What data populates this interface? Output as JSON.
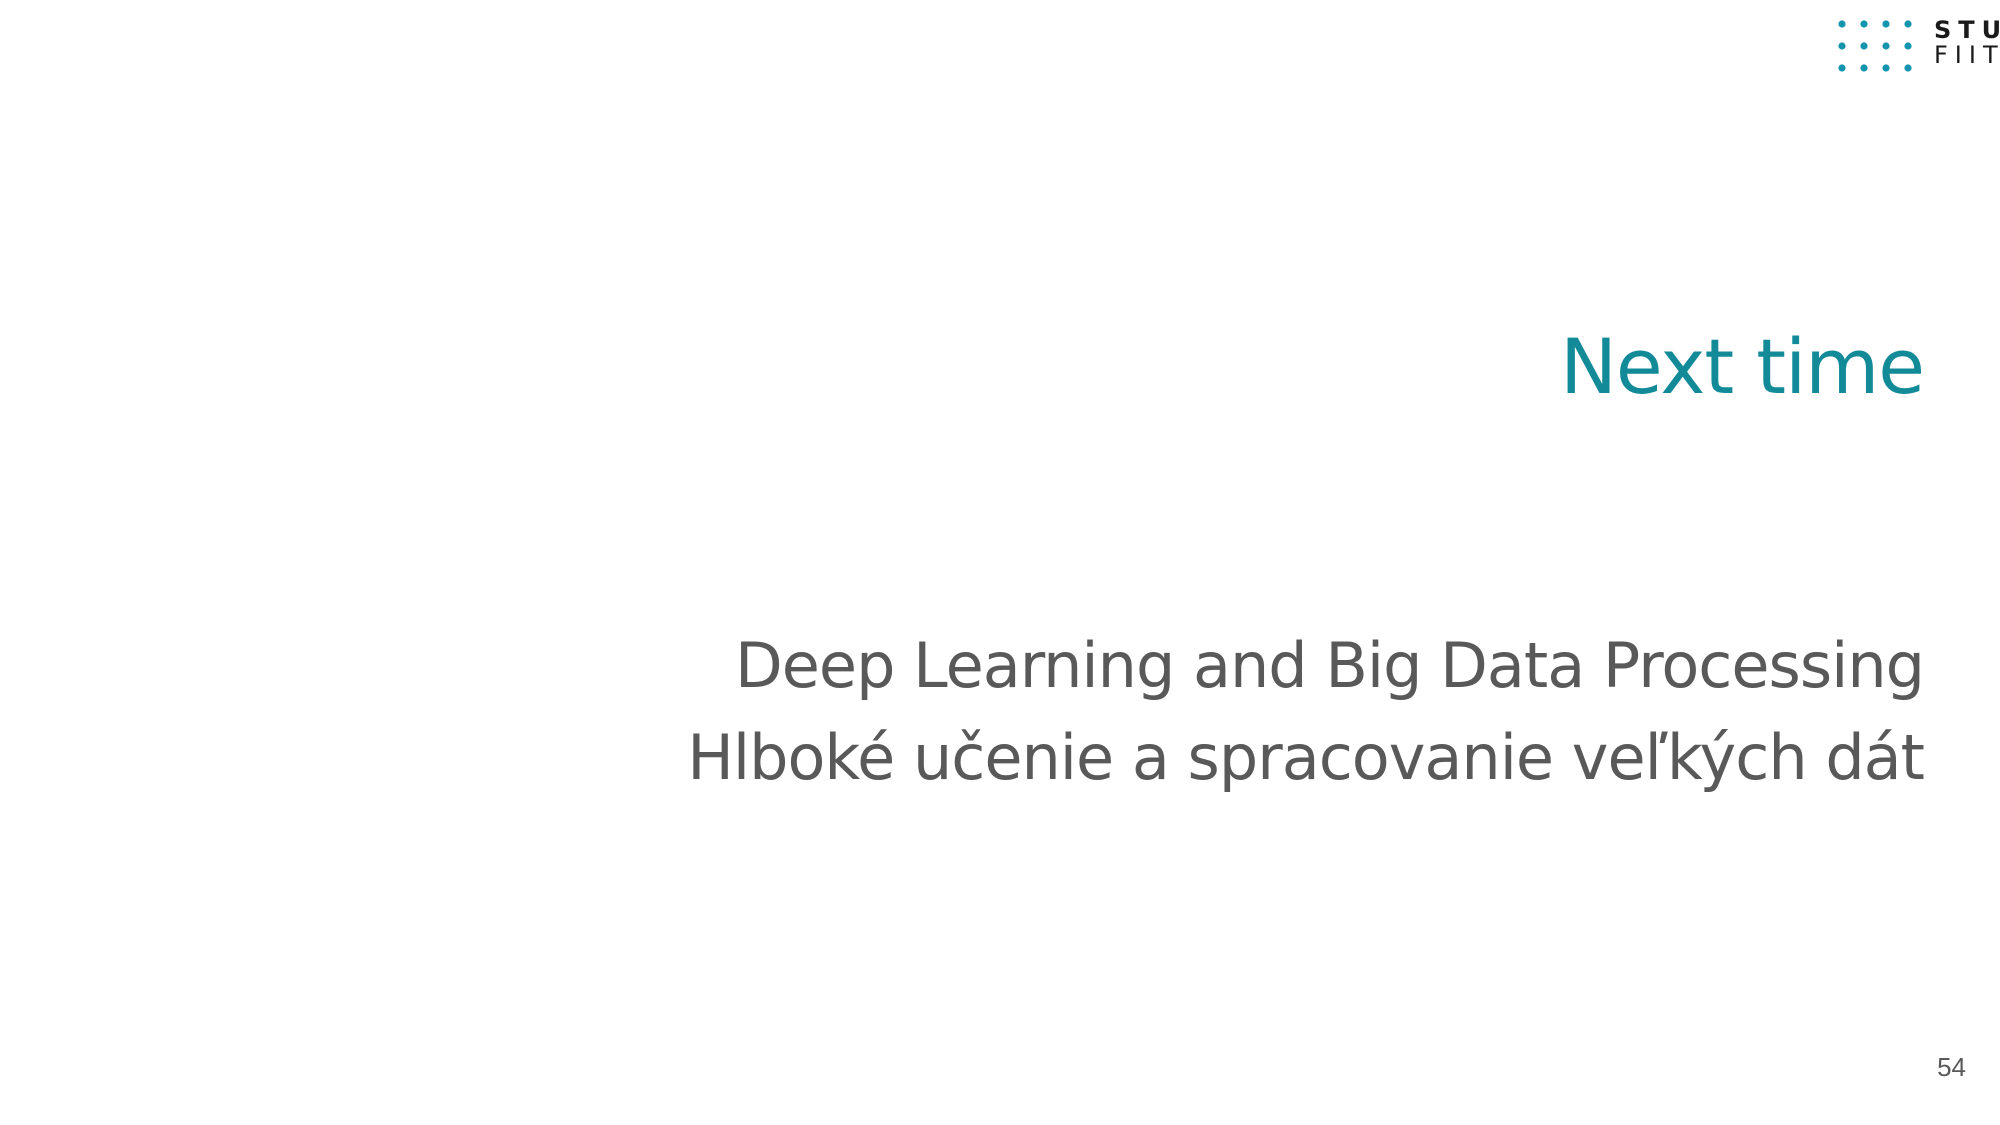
{
  "logo": {
    "line1": "STU",
    "line2": "FIIT",
    "dot_color": "#1494ad",
    "text_color": "#1a1a1a"
  },
  "slide": {
    "title": "Next time",
    "subtitle_line1": "Deep Learning and Big Data Processing",
    "subtitle_line2": "Hlboké učenie a spracovanie veľkých dát",
    "page_number": "54",
    "title_color": "#138a98",
    "text_color": "#595959"
  }
}
